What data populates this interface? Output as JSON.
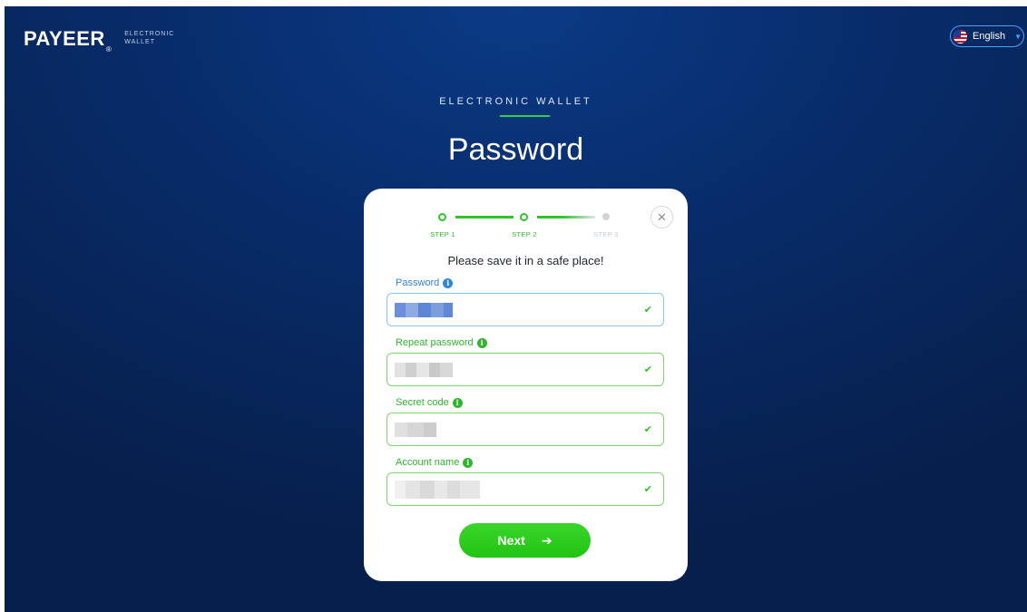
{
  "header": {
    "logo": "PAYEER",
    "logo_mark": "®",
    "logo_sub_line1": "ELECTRONIC",
    "logo_sub_line2": "WALLET",
    "language": "English",
    "language_icon": "us-flag-icon",
    "caret_icon": "chevron-down-icon"
  },
  "hero": {
    "kicker": "ELECTRONIC WALLET",
    "title": "Password"
  },
  "steps": [
    {
      "label": "STEP 1",
      "state": "done"
    },
    {
      "label": "STEP 2",
      "state": "current"
    },
    {
      "label": "STEP 3",
      "state": "todo"
    }
  ],
  "form": {
    "notice": "Please save it in a safe place!",
    "close_icon": "close-icon",
    "fields": [
      {
        "label": "Password",
        "value": "",
        "status": "valid"
      },
      {
        "label": "Repeat password",
        "value": "",
        "status": "valid"
      },
      {
        "label": "Secret code",
        "value": "",
        "status": "valid"
      },
      {
        "label": "Account name",
        "value": "",
        "status": "valid"
      }
    ],
    "next_label": "Next",
    "next_icon": "arrow-right-icon"
  },
  "colors": {
    "background": "#082c6a",
    "accent_green": "#2ccf1e",
    "accent_blue": "#2e86d9"
  }
}
